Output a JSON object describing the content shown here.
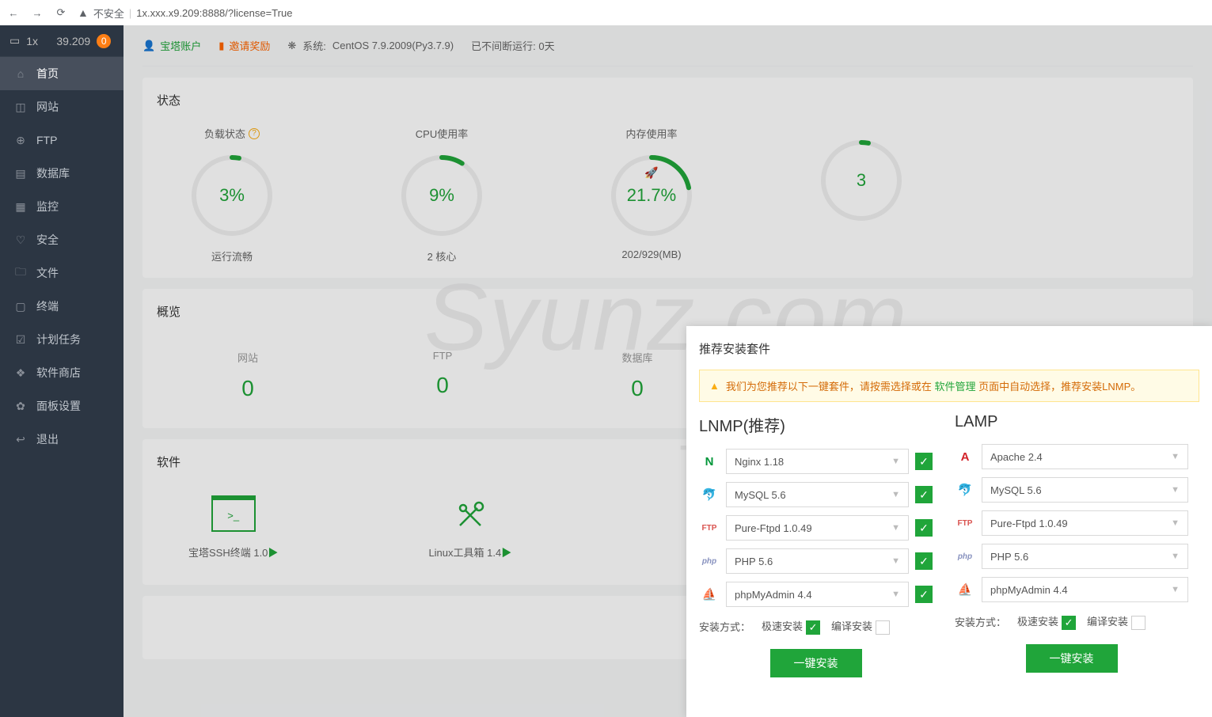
{
  "browser": {
    "insecure_label": "不安全",
    "url": "1x.xxx.x9.209:8888/?license=True",
    "ip_fragment_left": "1",
    "ip_fragment_right": "9.209"
  },
  "sidebar": {
    "server_ip_left": "1x",
    "server_ip_right": "39.209",
    "alert_count": "0",
    "items": [
      {
        "icon": "⌂",
        "label": "首页",
        "active": true
      },
      {
        "icon": "◫",
        "label": "网站"
      },
      {
        "icon": "⊕",
        "label": "FTP"
      },
      {
        "icon": "▤",
        "label": "数据库"
      },
      {
        "icon": "▦",
        "label": "监控"
      },
      {
        "icon": "♡",
        "label": "安全"
      },
      {
        "icon": "🗀",
        "label": "文件"
      },
      {
        "icon": "▢",
        "label": "终端"
      },
      {
        "icon": "☑",
        "label": "计划任务"
      },
      {
        "icon": "❖",
        "label": "软件商店"
      },
      {
        "icon": "✿",
        "label": "面板设置"
      },
      {
        "icon": "↩",
        "label": "退出"
      }
    ]
  },
  "topbar": {
    "account": "宝塔账户",
    "invite": "邀请奖励",
    "system_label": "系统:",
    "system_value": "CentOS 7.9.2009(Py3.7.9)",
    "uptime": "已不间断运行: 0天"
  },
  "status": {
    "title": "状态",
    "gauges": [
      {
        "label": "负载状态",
        "help": true,
        "pct": 3,
        "value": "3%",
        "sub": "运行流畅"
      },
      {
        "label": "CPU使用率",
        "pct": 9,
        "value": "9%",
        "sub": "2 核心"
      },
      {
        "label": "内存使用率",
        "pct": 21.7,
        "value": "21.7%",
        "sub": "202/929(MB)",
        "icon_rocket": true
      },
      {
        "label": "",
        "pct": 3,
        "value": "3",
        "sub": ""
      }
    ]
  },
  "overview": {
    "title": "概览",
    "cells": [
      {
        "label": "网站",
        "value": "0"
      },
      {
        "label": "FTP",
        "value": "0"
      },
      {
        "label": "数据库",
        "value": "0"
      }
    ]
  },
  "software": {
    "title": "软件",
    "items": [
      {
        "name": "宝塔SSH终端 1.0"
      },
      {
        "name": "Linux工具箱 1.4"
      }
    ]
  },
  "watermark": "Syunz.com",
  "wm2": "上 云   教 程",
  "modal": {
    "title": "推荐安装套件",
    "tip_prefix": "我们为您推荐以下一键套件，请按需选择或在",
    "tip_link": "软件管理",
    "tip_suffix": "页面中自动选择，推荐安装LNMP。",
    "stacks": [
      {
        "name": "LNMP(推荐)",
        "packages": [
          {
            "icon": "N",
            "icon_color": "#009639",
            "label": "Nginx 1.18",
            "checked": true
          },
          {
            "icon": "🐬",
            "icon_color": "#00758f",
            "label": "MySQL 5.6",
            "checked": true
          },
          {
            "icon": "FTP",
            "icon_color": "#d9534f",
            "label": "Pure-Ftpd 1.0.49",
            "checked": true
          },
          {
            "icon": "php",
            "icon_color": "#8892bf",
            "label": "PHP 5.6",
            "checked": true
          },
          {
            "icon": "⛵",
            "icon_color": "#f0ad4e",
            "label": "phpMyAdmin 4.4",
            "checked": true
          }
        ],
        "mode_label": "安装方式：",
        "mode_fast": "极速安装",
        "mode_compile": "编译安装",
        "fast_checked": true,
        "compile_checked": false,
        "button": "一键安装"
      },
      {
        "name": "LAMP",
        "packages": [
          {
            "icon": "A",
            "icon_color": "#d22128",
            "label": "Apache 2.4",
            "checked": true
          },
          {
            "icon": "🐬",
            "icon_color": "#00758f",
            "label": "MySQL 5.6",
            "checked": true
          },
          {
            "icon": "FTP",
            "icon_color": "#d9534f",
            "label": "Pure-Ftpd 1.0.49",
            "checked": true
          },
          {
            "icon": "php",
            "icon_color": "#8892bf",
            "label": "PHP 5.6",
            "checked": true
          },
          {
            "icon": "⛵",
            "icon_color": "#f0ad4e",
            "label": "phpMyAdmin 4.4",
            "checked": true
          }
        ],
        "mode_label": "安装方式：",
        "mode_fast": "极速安装",
        "mode_compile": "编译安装",
        "fast_checked": true,
        "compile_checked": false,
        "button": "一键安装"
      }
    ]
  }
}
